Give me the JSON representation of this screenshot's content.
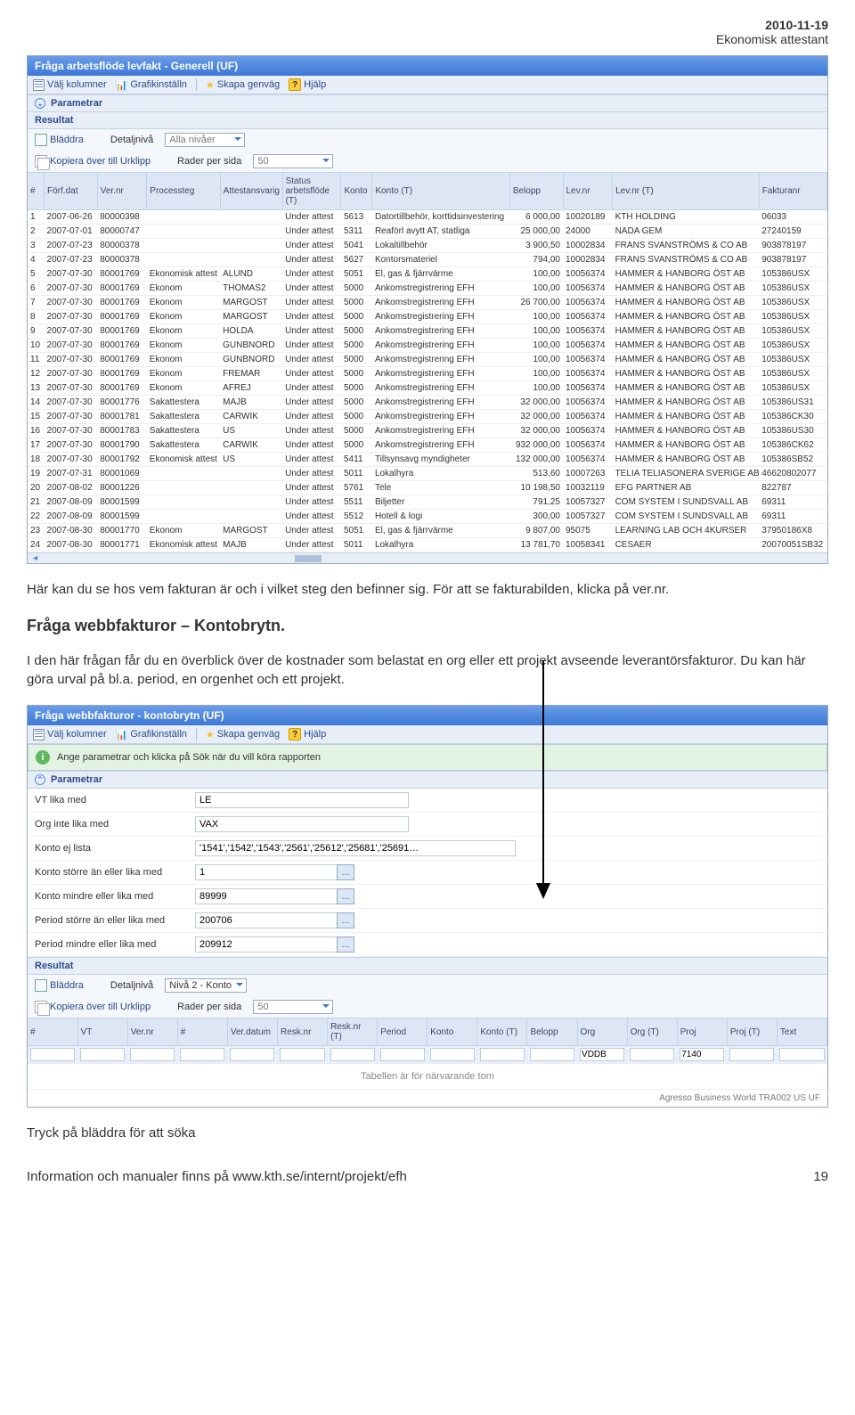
{
  "header": {
    "date": "2010-11-19",
    "subtitle": "Ekonomisk attestant"
  },
  "panel1": {
    "title": "Fråga arbetsflöde levfakt - Generell (UF)",
    "toolbar": {
      "cols": "Välj kolumner",
      "chart": "Grafikinställn",
      "shortcut": "Skapa genväg",
      "help": "Hjälp"
    },
    "sections": {
      "params": "Parametrar",
      "result": "Resultat"
    },
    "resultCtrls": {
      "browse": "Bläddra",
      "detailLabel": "Detaljnivå",
      "detailValue": "Alla nivåer",
      "copy": "Kopiera över till Urklipp",
      "rowsLabel": "Rader per sida",
      "rowsValue": "50"
    },
    "columns": [
      "#",
      "Förf.dat",
      "Ver.nr",
      "Processteg",
      "Attestansvarig",
      "Status arbetsflöde (T)",
      "Konto",
      "Konto (T)",
      "Belopp",
      "Lev.nr",
      "Lev.nr (T)",
      "Fakturanr"
    ],
    "rows": [
      {
        "n": 1,
        "dat": "2007-06-26",
        "ver": "80000398",
        "proc": "",
        "att": "",
        "stat": "Under attest",
        "konto": "5613",
        "kontoT": "Datortillbehör, korttidsinvestering",
        "bel": "6 000,00",
        "lev": "10020189",
        "levT": "KTH HOLDING",
        "fnr": "06033"
      },
      {
        "n": 2,
        "dat": "2007-07-01",
        "ver": "80000747",
        "proc": "",
        "att": "",
        "stat": "Under attest",
        "konto": "5311",
        "kontoT": "Reaförl avytt AT, statliga",
        "bel": "25 000,00",
        "lev": "24000",
        "levT": "NADA GEM",
        "fnr": "27240159"
      },
      {
        "n": 3,
        "dat": "2007-07-23",
        "ver": "80000378",
        "proc": "",
        "att": "",
        "stat": "Under attest",
        "konto": "5041",
        "kontoT": "Lokaltillbehör",
        "bel": "3 900,50",
        "lev": "10002834",
        "levT": "FRANS SVANSTRÖMS & CO AB",
        "fnr": "903878197"
      },
      {
        "n": 4,
        "dat": "2007-07-23",
        "ver": "80000378",
        "proc": "",
        "att": "",
        "stat": "Under attest",
        "konto": "5627",
        "kontoT": "Kontorsmateriel",
        "bel": "794,00",
        "lev": "10002834",
        "levT": "FRANS SVANSTRÖMS & CO AB",
        "fnr": "903878197"
      },
      {
        "n": 5,
        "dat": "2007-07-30",
        "ver": "80001769",
        "proc": "Ekonomisk attest",
        "att": "ALUND",
        "stat": "Under attest",
        "konto": "5051",
        "kontoT": "El, gas & fjärrvärme",
        "bel": "100,00",
        "lev": "10056374",
        "levT": "HAMMER & HANBORG ÖST AB",
        "fnr": "105386USX"
      },
      {
        "n": 6,
        "dat": "2007-07-30",
        "ver": "80001769",
        "proc": "Ekonom",
        "att": "THOMAS2",
        "stat": "Under attest",
        "konto": "5000",
        "kontoT": "Ankomstregistrering EFH",
        "bel": "100,00",
        "lev": "10056374",
        "levT": "HAMMER & HANBORG ÖST AB",
        "fnr": "105386USX"
      },
      {
        "n": 7,
        "dat": "2007-07-30",
        "ver": "80001769",
        "proc": "Ekonom",
        "att": "MARGOST",
        "stat": "Under attest",
        "konto": "5000",
        "kontoT": "Ankomstregistrering EFH",
        "bel": "26 700,00",
        "lev": "10056374",
        "levT": "HAMMER & HANBORG ÖST AB",
        "fnr": "105386USX"
      },
      {
        "n": 8,
        "dat": "2007-07-30",
        "ver": "80001769",
        "proc": "Ekonom",
        "att": "MARGOST",
        "stat": "Under attest",
        "konto": "5000",
        "kontoT": "Ankomstregistrering EFH",
        "bel": "100,00",
        "lev": "10056374",
        "levT": "HAMMER & HANBORG ÖST AB",
        "fnr": "105386USX"
      },
      {
        "n": 9,
        "dat": "2007-07-30",
        "ver": "80001769",
        "proc": "Ekonom",
        "att": "HOLDA",
        "stat": "Under attest",
        "konto": "5000",
        "kontoT": "Ankomstregistrering EFH",
        "bel": "100,00",
        "lev": "10056374",
        "levT": "HAMMER & HANBORG ÖST AB",
        "fnr": "105386USX"
      },
      {
        "n": 10,
        "dat": "2007-07-30",
        "ver": "80001769",
        "proc": "Ekonom",
        "att": "GUNBNORD",
        "stat": "Under attest",
        "konto": "5000",
        "kontoT": "Ankomstregistrering EFH",
        "bel": "100,00",
        "lev": "10056374",
        "levT": "HAMMER & HANBORG ÖST AB",
        "fnr": "105386USX"
      },
      {
        "n": 11,
        "dat": "2007-07-30",
        "ver": "80001769",
        "proc": "Ekonom",
        "att": "GUNBNORD",
        "stat": "Under attest",
        "konto": "5000",
        "kontoT": "Ankomstregistrering EFH",
        "bel": "100,00",
        "lev": "10056374",
        "levT": "HAMMER & HANBORG ÖST AB",
        "fnr": "105386USX"
      },
      {
        "n": 12,
        "dat": "2007-07-30",
        "ver": "80001769",
        "proc": "Ekonom",
        "att": "FREMAR",
        "stat": "Under attest",
        "konto": "5000",
        "kontoT": "Ankomstregistrering EFH",
        "bel": "100,00",
        "lev": "10056374",
        "levT": "HAMMER & HANBORG ÖST AB",
        "fnr": "105386USX"
      },
      {
        "n": 13,
        "dat": "2007-07-30",
        "ver": "80001769",
        "proc": "Ekonom",
        "att": "AFREJ",
        "stat": "Under attest",
        "konto": "5000",
        "kontoT": "Ankomstregistrering EFH",
        "bel": "100,00",
        "lev": "10056374",
        "levT": "HAMMER & HANBORG ÖST AB",
        "fnr": "105386USX"
      },
      {
        "n": 14,
        "dat": "2007-07-30",
        "ver": "80001776",
        "proc": "Sakattestera",
        "att": "MAJB",
        "stat": "Under attest",
        "konto": "5000",
        "kontoT": "Ankomstregistrering EFH",
        "bel": "32 000,00",
        "lev": "10056374",
        "levT": "HAMMER & HANBORG ÖST AB",
        "fnr": "105386US31"
      },
      {
        "n": 15,
        "dat": "2007-07-30",
        "ver": "80001781",
        "proc": "Sakattestera",
        "att": "CARWIK",
        "stat": "Under attest",
        "konto": "5000",
        "kontoT": "Ankomstregistrering EFH",
        "bel": "32 000,00",
        "lev": "10056374",
        "levT": "HAMMER & HANBORG ÖST AB",
        "fnr": "105386CK30"
      },
      {
        "n": 16,
        "dat": "2007-07-30",
        "ver": "80001783",
        "proc": "Sakattestera",
        "att": "US",
        "stat": "Under attest",
        "konto": "5000",
        "kontoT": "Ankomstregistrering EFH",
        "bel": "32 000,00",
        "lev": "10056374",
        "levT": "HAMMER & HANBORG ÖST AB",
        "fnr": "105386US30"
      },
      {
        "n": 17,
        "dat": "2007-07-30",
        "ver": "80001790",
        "proc": "Sakattestera",
        "att": "CARWIK",
        "stat": "Under attest",
        "konto": "5000",
        "kontoT": "Ankomstregistrering EFH",
        "bel": "932 000,00",
        "lev": "10056374",
        "levT": "HAMMER & HANBORG ÖST AB",
        "fnr": "105386CK62"
      },
      {
        "n": 18,
        "dat": "2007-07-30",
        "ver": "80001792",
        "proc": "Ekonomisk attest",
        "att": "US",
        "stat": "Under attest",
        "konto": "5411",
        "kontoT": "Tillsynsavg myndigheter",
        "bel": "132 000,00",
        "lev": "10056374",
        "levT": "HAMMER & HANBORG ÖST AB",
        "fnr": "105386SB52"
      },
      {
        "n": 19,
        "dat": "2007-07-31",
        "ver": "80001069",
        "proc": "",
        "att": "",
        "stat": "Under attest",
        "konto": "5011",
        "kontoT": "Lokalhyra",
        "bel": "513,60",
        "lev": "10007263",
        "levT": "TELIA TELIASONERA SVERIGE AB",
        "fnr": "46620802077"
      },
      {
        "n": 20,
        "dat": "2007-08-02",
        "ver": "80001226",
        "proc": "",
        "att": "",
        "stat": "Under attest",
        "konto": "5761",
        "kontoT": "Tele",
        "bel": "10 198,50",
        "lev": "10032119",
        "levT": "EFG PARTNER AB",
        "fnr": "822787"
      },
      {
        "n": 21,
        "dat": "2007-08-09",
        "ver": "80001599",
        "proc": "",
        "att": "",
        "stat": "Under attest",
        "konto": "5511",
        "kontoT": "Biljetter",
        "bel": "791,25",
        "lev": "10057327",
        "levT": "COM SYSTEM I SUNDSVALL AB",
        "fnr": "69311"
      },
      {
        "n": 22,
        "dat": "2007-08-09",
        "ver": "80001599",
        "proc": "",
        "att": "",
        "stat": "Under attest",
        "konto": "5512",
        "kontoT": "Hotell & logi",
        "bel": "300,00",
        "lev": "10057327",
        "levT": "COM SYSTEM I SUNDSVALL AB",
        "fnr": "69311"
      },
      {
        "n": 23,
        "dat": "2007-08-30",
        "ver": "80001770",
        "proc": "Ekonom",
        "att": "MARGOST",
        "stat": "Under attest",
        "konto": "5051",
        "kontoT": "El, gas & fjärrvärme",
        "bel": "9 807,00",
        "lev": "95075",
        "levT": "LEARNING LAB OCH 4KURSER",
        "fnr": "37950186X8"
      },
      {
        "n": 24,
        "dat": "2007-08-30",
        "ver": "80001771",
        "proc": "Ekonomisk attest",
        "att": "MAJB",
        "stat": "Under attest",
        "konto": "5011",
        "kontoT": "Lokalhyra",
        "bel": "13 781,70",
        "lev": "10058341",
        "levT": "CESAER",
        "fnr": "20070051SB32"
      }
    ]
  },
  "prose": {
    "p1": "Här kan du se hos vem fakturan är och i vilket steg den befinner sig. För att se fakturabilden, klicka på ver.nr.",
    "h2": "Fråga webbfakturor – Kontobrytn.",
    "p2": "I den här frågan får du en överblick över de kostnader som belastat en org eller ett projekt avseende leverantörsfakturor. Du kan här göra urval på bl.a. period, en orgenhet och ett projekt.",
    "search": "Tryck på bläddra för att söka"
  },
  "panel2": {
    "title": "Fråga webbfakturor - kontobrytn (UF)",
    "banner": "Ange parametrar och klicka på Sök när du vill köra rapporten",
    "params": [
      {
        "label": "VT lika med",
        "value": "LE",
        "browse": false
      },
      {
        "label": "Org inte lika med",
        "value": "VAX",
        "browse": false
      },
      {
        "label": "Konto ej lista",
        "value": "'1541','1542','1543','2561','25612','25681','25691…",
        "browse": false,
        "wide": true
      },
      {
        "label": "Konto större än eller lika med",
        "value": "1",
        "browse": true
      },
      {
        "label": "Konto mindre eller lika med",
        "value": "89999",
        "browse": true
      },
      {
        "label": "Period större än eller lika med",
        "value": "200706",
        "browse": true
      },
      {
        "label": "Period mindre eller lika med",
        "value": "209912",
        "browse": true
      }
    ],
    "resultCtrls": {
      "browse": "Bläddra",
      "detailLabel": "Detaljnivå",
      "detailValue": "Nivå 2 - Konto",
      "copy": "Kopiera över till Urklipp",
      "rowsLabel": "Rader per sida",
      "rowsValue": "50"
    },
    "columns": [
      "#",
      "VT",
      "Ver.nr",
      "#",
      "Ver.datum",
      "Resk.nr",
      "Resk.nr (T)",
      "Period",
      "Konto",
      "Konto (T)",
      "Belopp",
      "Org",
      "Org (T)",
      "Proj",
      "Proj (T)",
      "Text"
    ],
    "filter": {
      "org": "VDDB",
      "proj": "7140"
    },
    "emptyMsg": "Tabellen är för närvarande tom",
    "footer": "Agresso Business World  TRA002  US  UF"
  },
  "footer": {
    "info": "Information och manualer finns på www.kth.se/internt/projekt/efh",
    "page": "19"
  }
}
